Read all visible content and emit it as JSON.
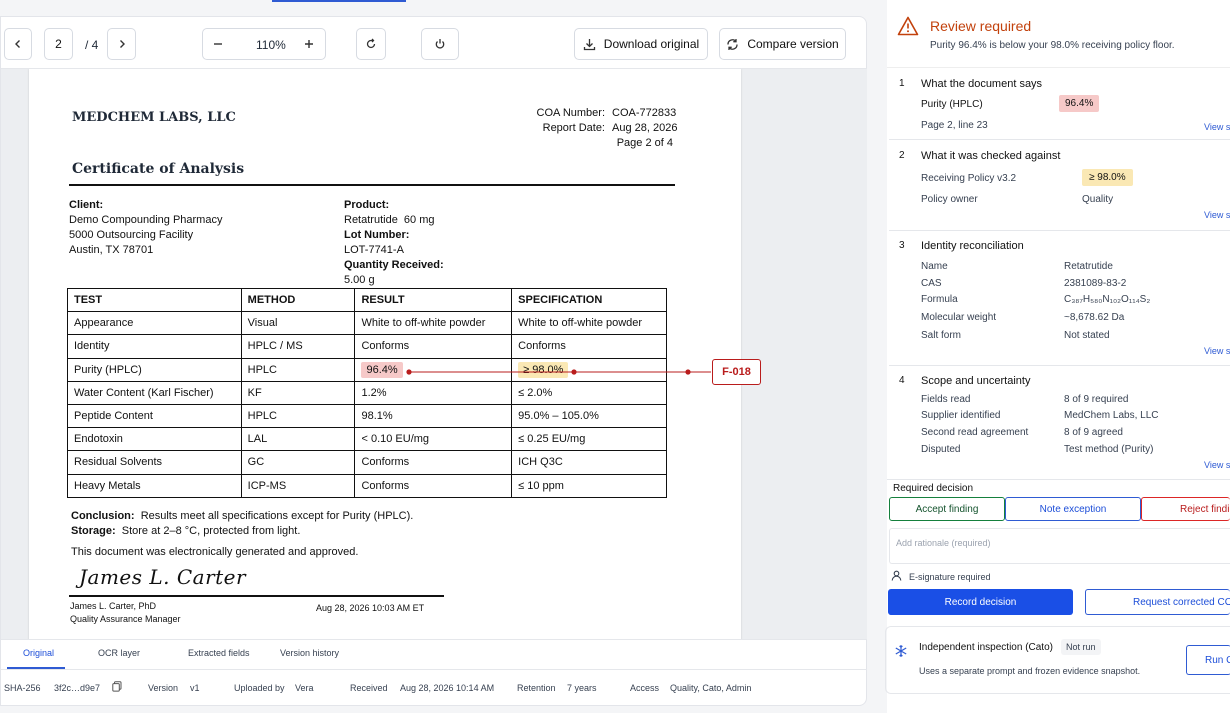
{
  "toolbar": {
    "page_current": "2",
    "page_total": "/ 4",
    "zoom": "110%",
    "download_label": "Download original",
    "compare_label": "Compare version"
  },
  "document": {
    "company": "MEDCHEM LABS, LLC",
    "coa_number_label": "COA Number:",
    "coa_number": "COA-772833",
    "report_date_label": "Report Date:",
    "report_date": "Aug 28, 2026",
    "page_of": "Page 2 of 4",
    "title": "Certificate of Analysis",
    "client_label": "Client:",
    "client_line1": "Demo Compounding Pharmacy",
    "client_line2": "5000 Outsourcing Facility",
    "client_line3": "Austin, TX 78701",
    "product_label": "Product:",
    "product": "Retatrutide  60 mg",
    "lot_label": "Lot Number:",
    "lot": "LOT-7741-A",
    "qty_label": "Quantity Received:",
    "qty": "5.00 g",
    "table_headers": [
      "TEST",
      "METHOD",
      "RESULT",
      "SPECIFICATION"
    ],
    "rows": [
      [
        "Appearance",
        "Visual",
        "White to off-white powder",
        "White to off-white powder"
      ],
      [
        "Identity",
        "HPLC / MS",
        "Conforms",
        "Conforms"
      ],
      [
        "Purity (HPLC)",
        "HPLC",
        "96.4%",
        "≥ 98.0%"
      ],
      [
        "Water Content (Karl Fischer)",
        "KF",
        "1.2%",
        "≤ 2.0%"
      ],
      [
        "Peptide Content",
        "HPLC",
        "98.1%",
        "95.0% – 105.0%"
      ],
      [
        "Endotoxin",
        "LAL",
        "< 0.10 EU/mg",
        "≤ 0.25 EU/mg"
      ],
      [
        "Residual Solvents",
        "GC",
        "Conforms",
        "ICH Q3C"
      ],
      [
        "Heavy Metals",
        "ICP-MS",
        "Conforms",
        "≤ 10 ppm"
      ]
    ],
    "finding_tag": "F-018",
    "conclusion_label": "Conclusion:",
    "conclusion": "Results meet all specifications except for Purity (HPLC).",
    "storage_label": "Storage:",
    "storage": "Store at 2–8 °C, protected from light.",
    "generated": "This document was electronically generated and approved.",
    "signature": "James L. Carter",
    "signer_name": "James L. Carter, PhD",
    "signer_title": "Quality Assurance Manager",
    "signed_at": "Aug 28, 2026 10:03 AM ET"
  },
  "tabs": [
    "Original",
    "OCR layer",
    "Extracted fields",
    "Version history"
  ],
  "meta": {
    "sha_label": "SHA-256",
    "sha": "3f2c…d9e7",
    "version_label": "Version",
    "version": "v1",
    "uploaded_label": "Uploaded by",
    "uploaded_by": "Vera",
    "received_label": "Received",
    "received": "Aug 28, 2026 10:14 AM",
    "retention_label": "Retention",
    "retention": "7 years",
    "access_label": "Access",
    "access": "Quality, Cato, Admin"
  },
  "review": {
    "title": "Review required",
    "subtitle": "Purity 96.4% is below your 98.0% receiving policy floor.",
    "s1_num": "1",
    "s1_title": "What the document says",
    "s1_field": "Purity (HPLC)",
    "s1_value": "96.4%",
    "s1_loc": "Page 2, line 23",
    "s2_num": "2",
    "s2_title": "What it was checked against",
    "s2_policy": "Receiving Policy v3.2",
    "s2_threshold": "≥ 98.0%",
    "s2_owner_label": "Policy owner",
    "s2_owner": "Quality",
    "s3_num": "3",
    "s3_title": "Identity reconciliation",
    "s3_rows": [
      [
        "Name",
        "Retatrutide"
      ],
      [
        "CAS",
        "2381089-83-2"
      ],
      [
        "Formula",
        "C₃₈₇H₅₈₀N₁₀₂O₁₁₄S₂"
      ],
      [
        "Molecular weight",
        "~8,678.62 Da"
      ],
      [
        "Salt form",
        "Not stated"
      ]
    ],
    "s4_num": "4",
    "s4_title": "Scope and uncertainty",
    "s4_rows": [
      [
        "Fields read",
        "8 of 9 required"
      ],
      [
        "Supplier identified",
        "MedChem Labs, LLC"
      ],
      [
        "Second read agreement",
        "8 of 9 agreed"
      ],
      [
        "Disputed",
        "Test method (Purity)"
      ]
    ],
    "view_link": "View s",
    "decision_label": "Required decision",
    "accept": "Accept finding",
    "note": "Note exception",
    "reject": "Reject findin",
    "rationale_placeholder": "Add rationale (required)",
    "esig": "E-signature required",
    "record": "Record decision",
    "request": "Request corrected COA",
    "cato_title": "Independent inspection (Cato)",
    "cato_status": "Not run",
    "cato_desc": "Uses a separate prompt and frozen evidence snapshot.",
    "run": "Run C"
  },
  "colors": {
    "accent": "#1a4fe6",
    "warning": "#c2410c",
    "error": "#b91c1c",
    "success": "#15803d"
  }
}
